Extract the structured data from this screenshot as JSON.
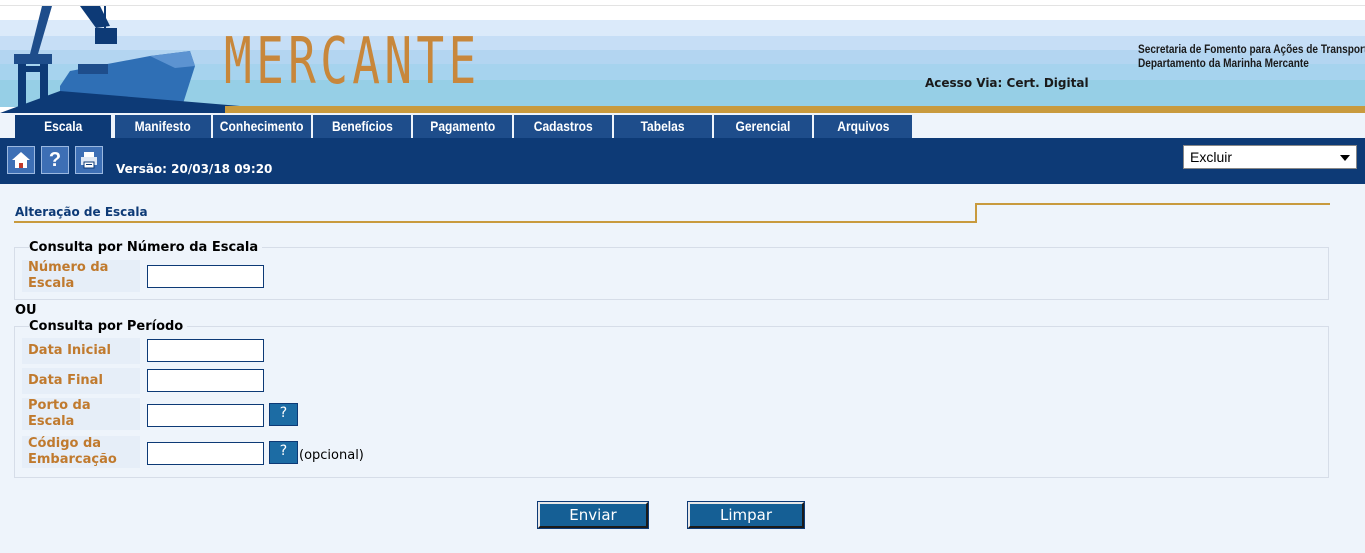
{
  "header": {
    "logo": "MERCANTE",
    "ministry_line1": "Secretaria de Fomento para Ações de Transportes",
    "ministry_line2": "Departamento da Marinha Mercante",
    "access": "Acesso Via: Cert. Digital"
  },
  "tabs": [
    {
      "label": "Escala",
      "active": true
    },
    {
      "label": "Manifesto",
      "active": false
    },
    {
      "label": "Conhecimento",
      "active": false
    },
    {
      "label": "Benefícios",
      "active": false
    },
    {
      "label": "Pagamento",
      "active": false
    },
    {
      "label": "Cadastros",
      "active": false
    },
    {
      "label": "Tabelas",
      "active": false
    },
    {
      "label": "Gerencial",
      "active": false
    },
    {
      "label": "Arquivos",
      "active": false
    }
  ],
  "toolbar": {
    "home_icon": "home-icon",
    "help_icon": "help-icon",
    "print_icon": "print-icon",
    "version": "Versão: 20/03/18 09:20",
    "action_select": "Excluir"
  },
  "page": {
    "title": "Alteração de Escala",
    "or_label": "OU"
  },
  "by_number": {
    "legend": "Consulta por Número da Escala",
    "number_label_1": "Número da",
    "number_label_2": "Escala",
    "number_value": ""
  },
  "by_period": {
    "legend": "Consulta por Período",
    "start_label": "Data Inicial",
    "start_value": "",
    "end_label": "Data Final",
    "end_value": "",
    "port_label_1": "Porto da",
    "port_label_2": "Escala",
    "port_value": "",
    "port_lookup": "?",
    "vessel_label_1": "Código da",
    "vessel_label_2": "Embarcação",
    "vessel_value": "",
    "vessel_lookup": "?",
    "optional": "(opcional)"
  },
  "actions": {
    "submit": "Enviar",
    "clear": "Limpar"
  },
  "colors": {
    "navy": "#0d3a76",
    "tab_blue": "#1e4d8b",
    "gold": "#c89a3e",
    "label_orange": "#c07a2e"
  }
}
